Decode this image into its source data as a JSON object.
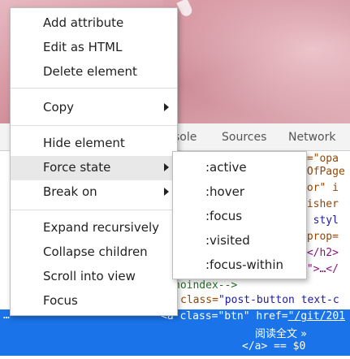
{
  "devtools": {
    "tabs": [
      {
        "label": "sole"
      },
      {
        "label": "Sources"
      },
      {
        "label": "Network"
      }
    ]
  },
  "code_snippets": {
    "right_fragments": [
      "e=\"opa",
      "yOfPage",
      "hor\" i",
      "lisher",
      "\" styl",
      "mprop=",
      "…</h2>",
      "c\">…</"
    ],
    "comment_line": "noindex-->",
    "class_line_attr": "class=",
    "class_line_val": "\"post-button text-c",
    "selected_line_1_prefix": "<a ",
    "selected_line_1_attr1": "class=",
    "selected_line_1_val1": "\"btn\"",
    "selected_line_1_attr2": " href=",
    "selected_line_1_val2": "\"/git/201",
    "selected_text": "阅读全文 »",
    "selected_close": "</a> == $0",
    "ellipsis": "…"
  },
  "context_menu": {
    "items": [
      {
        "label": "Add attribute"
      },
      {
        "label": "Edit as HTML"
      },
      {
        "label": "Delete element"
      },
      {
        "label": "Copy",
        "has_submenu": true
      },
      {
        "label": "Hide element"
      },
      {
        "label": "Force state",
        "has_submenu": true,
        "highlighted": true
      },
      {
        "label": "Break on",
        "has_submenu": true
      },
      {
        "label": "Expand recursively"
      },
      {
        "label": "Collapse children"
      },
      {
        "label": "Scroll into view"
      },
      {
        "label": "Focus"
      }
    ]
  },
  "force_state_submenu": {
    "items": [
      {
        "label": ":active"
      },
      {
        "label": ":hover"
      },
      {
        "label": ":focus"
      },
      {
        "label": ":visited"
      },
      {
        "label": ":focus-within"
      }
    ]
  },
  "colors": {
    "selection": "#1a73e8",
    "menu_hover": "#e8e8e8",
    "tag": "#881280",
    "attr": "#994500",
    "value": "#1a1aa6",
    "comment": "#236e25"
  }
}
